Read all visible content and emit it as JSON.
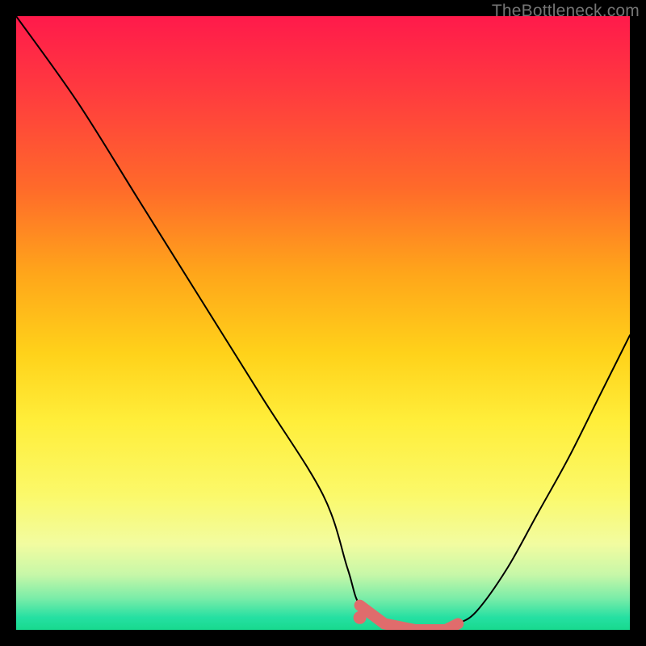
{
  "watermark": "TheBottleneck.com",
  "chart_data": {
    "type": "line",
    "title": "",
    "xlabel": "",
    "ylabel": "",
    "xlim": [
      0,
      100
    ],
    "ylim": [
      0,
      100
    ],
    "series": [
      {
        "name": "bottleneck-curve",
        "x": [
          0,
          10,
          20,
          30,
          40,
          50,
          54,
          56,
          60,
          65,
          70,
          72,
          75,
          80,
          85,
          90,
          95,
          100
        ],
        "y": [
          100,
          86,
          70,
          54,
          38,
          22,
          10,
          4,
          1,
          0,
          0,
          1,
          3,
          10,
          19,
          28,
          38,
          48
        ]
      }
    ],
    "annotations": [
      {
        "name": "optimal-range",
        "x_start": 56,
        "x_end": 72,
        "y": 0,
        "style": "thick-coral"
      },
      {
        "name": "optimal-start-dot",
        "x": 56,
        "y": 2,
        "style": "coral-dot"
      }
    ],
    "colors": {
      "curve": "#000000",
      "highlight": "#e06c6c"
    }
  }
}
